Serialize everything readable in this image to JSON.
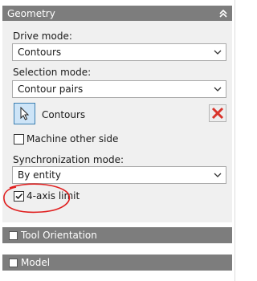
{
  "geometry": {
    "title": "Geometry",
    "drive_mode_label": "Drive mode:",
    "drive_mode_value": "Contours",
    "selection_mode_label": "Selection mode:",
    "selection_mode_value": "Contour pairs",
    "contours_label": "Contours",
    "machine_other_side_label": "Machine other side",
    "machine_other_side_checked": false,
    "sync_mode_label": "Synchronization mode:",
    "sync_mode_value": "By entity",
    "four_axis_limit_label": "4-axis limit",
    "four_axis_limit_checked": true
  },
  "tool_orientation": {
    "title": "Tool Orientation"
  },
  "model": {
    "title": "Model"
  },
  "colors": {
    "header_bg": "#7d7d7d",
    "body_bg": "#f0f0f0",
    "button_selected_bg": "#cde4f7",
    "button_selected_border": "#3c7fb1",
    "delete_red": "#d9342b",
    "annotation_red": "#e02020"
  },
  "icons": {
    "collapse": "double-chevron-up-icon",
    "dropdown": "chevron-down-icon",
    "pick": "cursor-arrow-icon",
    "delete": "red-x-icon"
  }
}
